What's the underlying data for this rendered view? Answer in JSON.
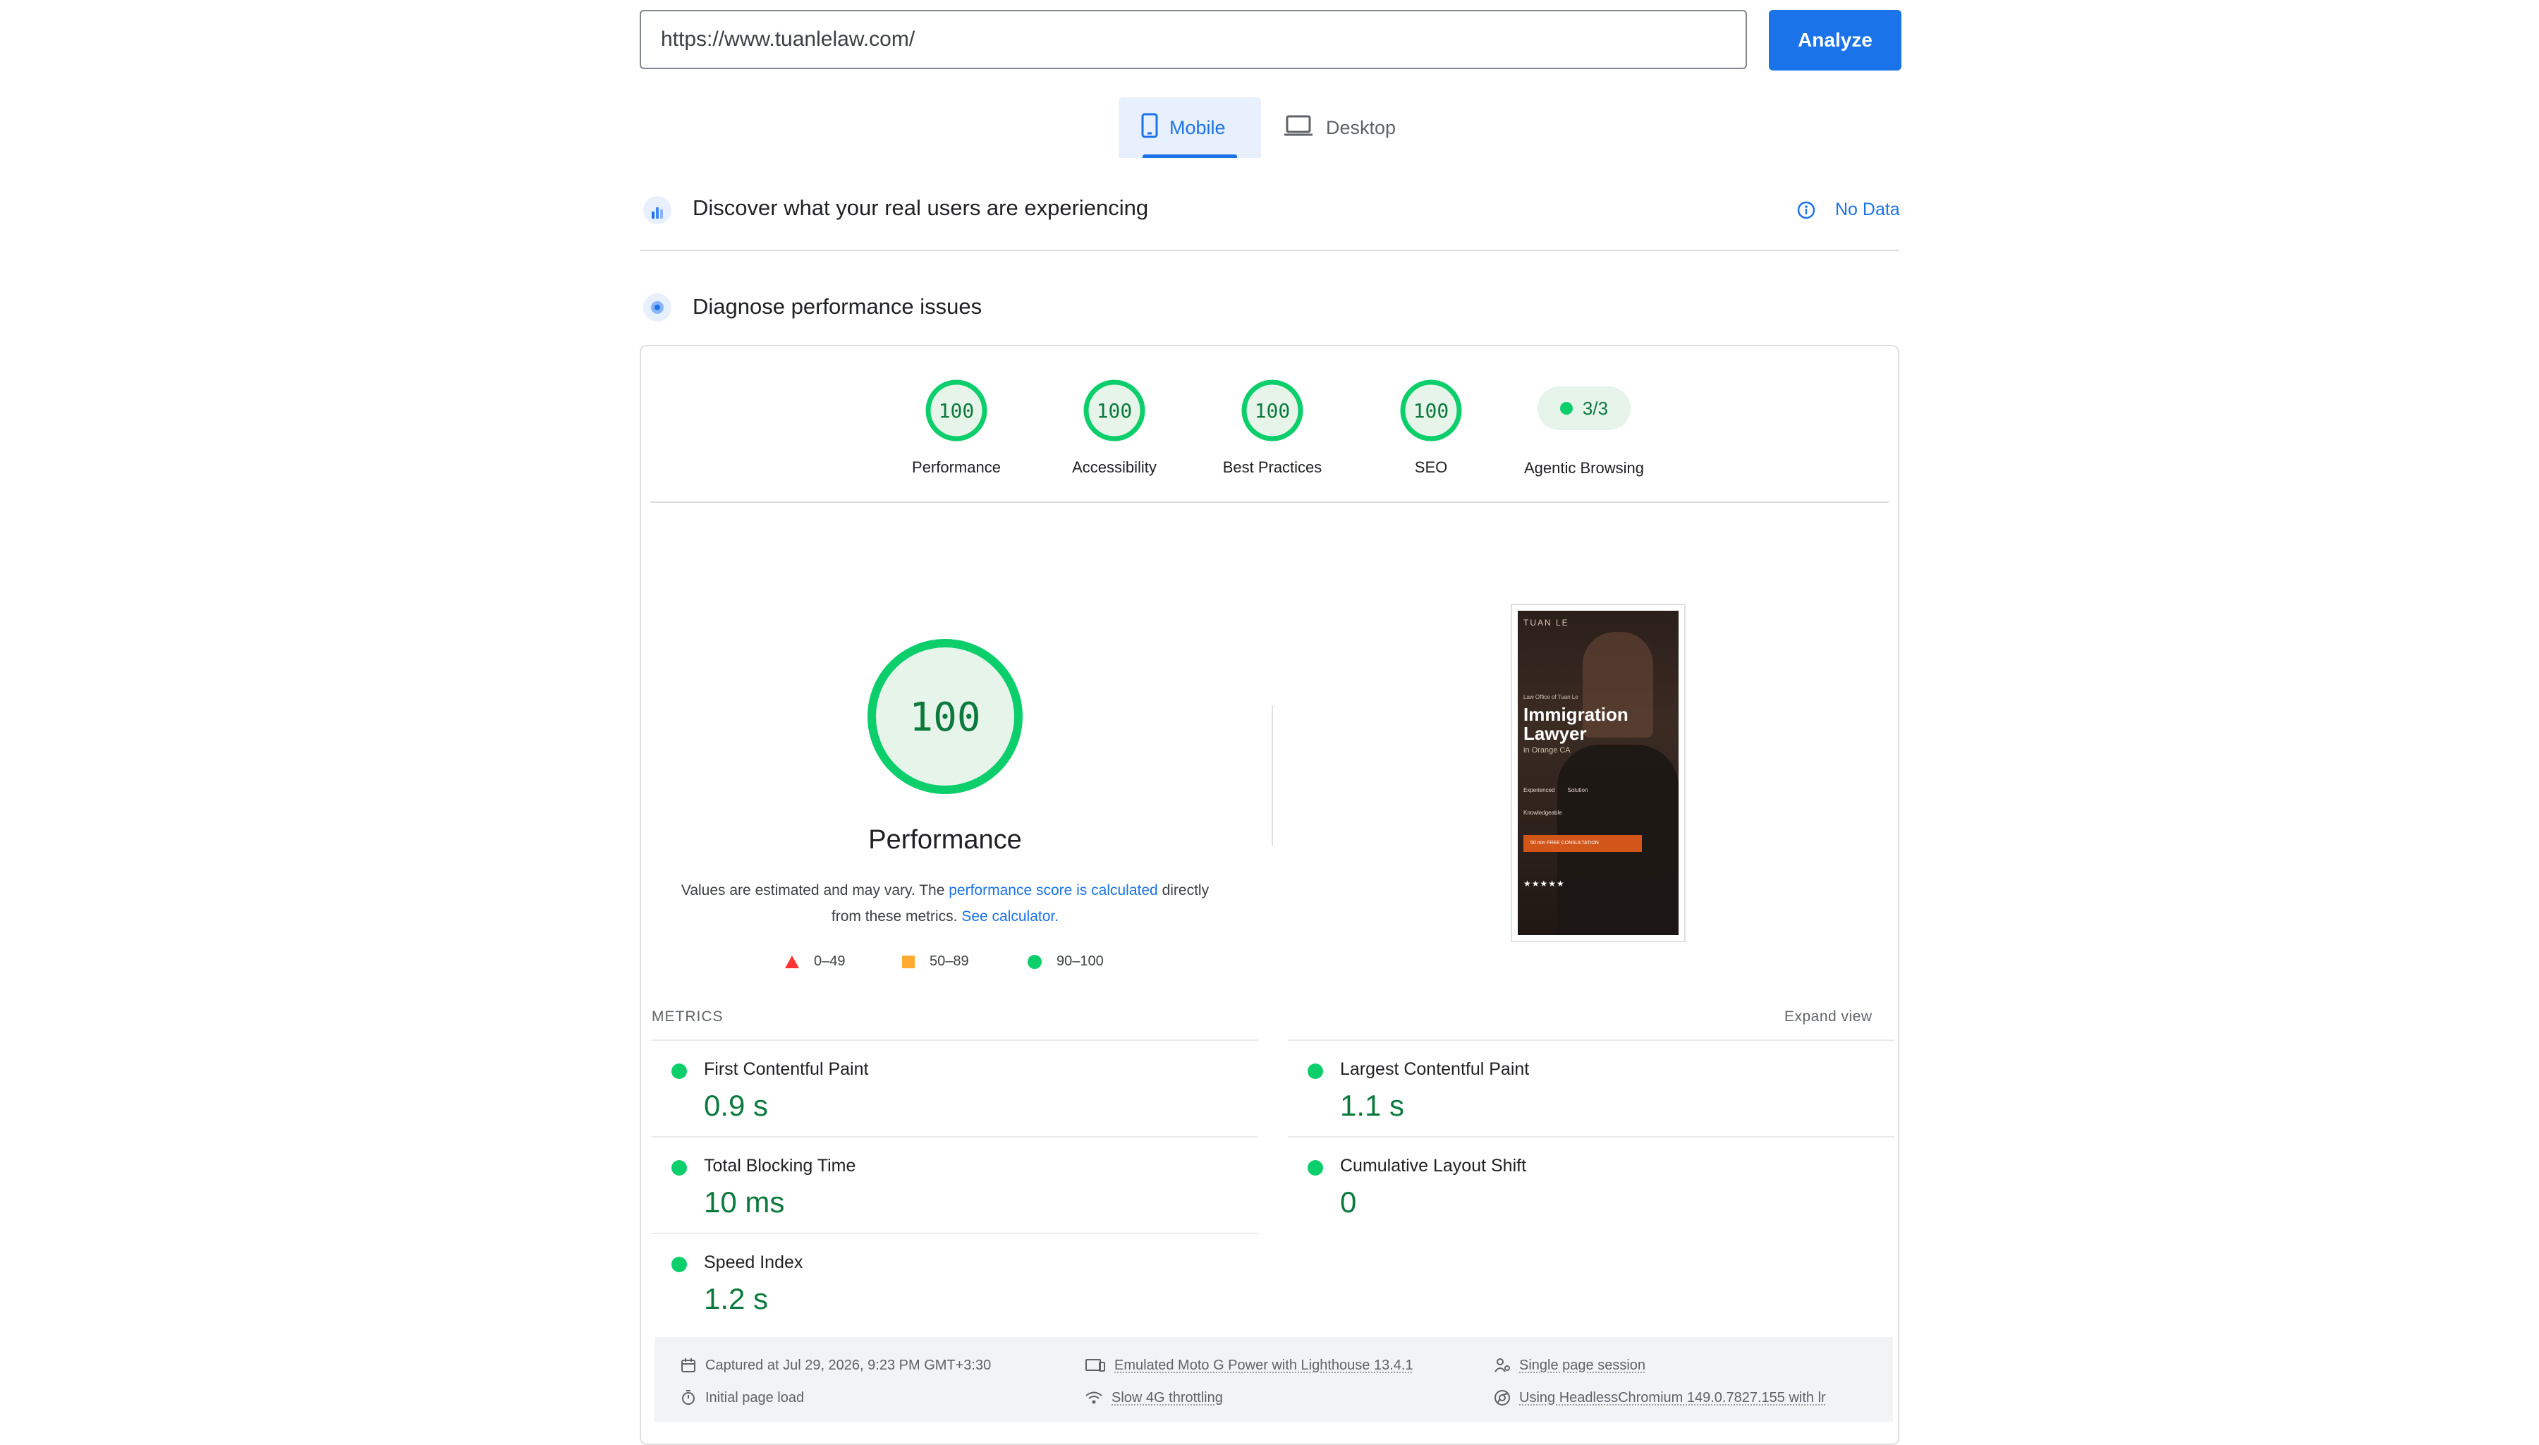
{
  "search": {
    "url_value": "https://www.tuanlelaw.com/",
    "analyze_label": "Analyze"
  },
  "tabs": [
    {
      "label": "Mobile",
      "icon": "smartphone-icon",
      "selected": true
    },
    {
      "label": "Desktop",
      "icon": "laptop-icon",
      "selected": false
    }
  ],
  "field_data": {
    "title": "Discover what your real users are experiencing",
    "status": "No Data",
    "icon": "crux-icon",
    "status_icon": "info-icon"
  },
  "lab_data": {
    "title": "Diagnose performance issues",
    "icon": "lighthouse-icon"
  },
  "categories": [
    {
      "label": "Performance",
      "score": "100"
    },
    {
      "label": "Accessibility",
      "score": "100"
    },
    {
      "label": "Best Practices",
      "score": "100"
    },
    {
      "label": "SEO",
      "score": "100"
    },
    {
      "label": "Agentic Browsing",
      "score": "3/3"
    }
  ],
  "performance": {
    "score": "100",
    "title": "Performance",
    "desc_prefix": "Values are estimated and may vary. The ",
    "desc_link1": "performance score is calculated",
    "desc_middle": " directly from these metrics. ",
    "desc_link2": "See calculator."
  },
  "legend": [
    {
      "range": "0–49",
      "shape": "triangle",
      "color": "#ff3333"
    },
    {
      "range": "50–89",
      "shape": "square",
      "color": "#ffaa33"
    },
    {
      "range": "90–100",
      "shape": "circle",
      "color": "#0cce6b"
    }
  ],
  "screenshot": {
    "brand": "TUAN LE",
    "kicker": "Law Office of Tuan Le",
    "headline1": "Immigration",
    "headline2": "Lawyer",
    "subline": "in Orange CA",
    "tag1": "Experienced",
    "tag2": "Solution",
    "tag3": "Knowledgeable",
    "cta": "50 min FREE CONSULTATION",
    "stars": "★★★★★"
  },
  "metrics": {
    "header": "METRICS",
    "expand_label": "Expand view",
    "items": [
      {
        "label": "First Contentful Paint",
        "value": "0.9 s"
      },
      {
        "label": "Largest Contentful Paint",
        "value": "1.1 s"
      },
      {
        "label": "Total Blocking Time",
        "value": "10 ms"
      },
      {
        "label": "Cumulative Layout Shift",
        "value": "0"
      },
      {
        "label": "Speed Index",
        "value": "1.2 s"
      }
    ]
  },
  "footer": {
    "captured": "Captured at Jul 29, 2026, 9:23 PM GMT+3:30",
    "initial_load": "Initial page load",
    "emulated": "Emulated Moto G Power with Lighthouse 13.4.1",
    "throttling": "Slow 4G throttling",
    "session": "Single page session",
    "browser": "Using HeadlessChromium 149.0.7827.155 with lr"
  },
  "colors": {
    "accent": "#1a73e8",
    "pass_green": "#0cce6b",
    "pass_text": "#0c7a3e",
    "pass_fill": "#e6f4ea"
  }
}
